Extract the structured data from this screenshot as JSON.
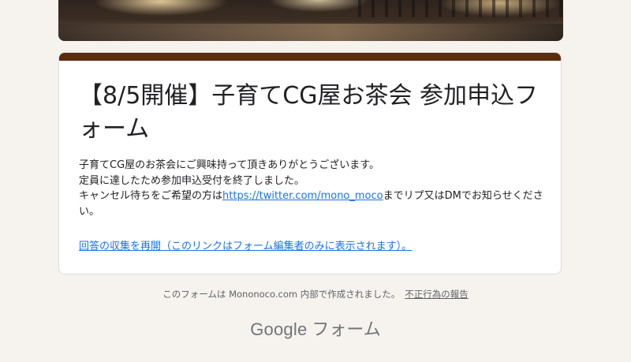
{
  "form": {
    "title": "【8/5開催】子育てCG屋お茶会 参加申込フォーム",
    "description": {
      "line1": "子育てCG屋のお茶会にご興味持って頂きありがとうございます。",
      "line2": "定員に達したため参加申込受付を終了しました。",
      "line3_before": "キャンセル待ちをご希望の方は",
      "link_text": "https://twitter.com/mono_moco",
      "line3_after": "までリプ又はDMでお知らせください。"
    },
    "reopen_link": "回答の収集を再開（このリンクはフォーム編集者のみに表示されます）。",
    "accent_color": "#5a2d0c"
  },
  "footer": {
    "note": "このフォームは Mononoco.com 内部で作成されました。",
    "report_link": "不正行為の報告",
    "brand_google": "Google",
    "brand_forms": "フォーム"
  }
}
